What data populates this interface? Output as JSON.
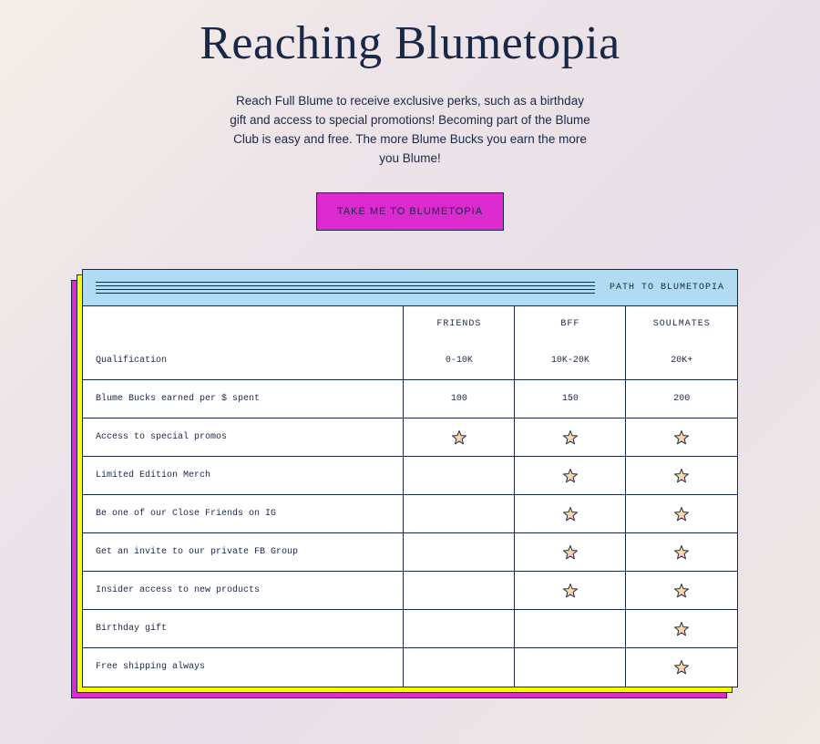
{
  "hero": {
    "title": "Reaching Blumetopia",
    "subtitle": "Reach Full Blume to receive exclusive perks, such as a birthday gift and access to special promotions! Becoming part of the Blume Club is easy and free. The more Blume Bucks you earn the more you Blume!",
    "cta": "TAKE ME TO BLUMETOPIA"
  },
  "card": {
    "header_label": "PATH TO BLUMETOPIA",
    "columns": [
      "",
      "FRIENDS",
      "BFF",
      "SOULMATES"
    ],
    "rows": [
      {
        "label": "Qualification",
        "cells": [
          "0-10K",
          "10K-20K",
          "20K+"
        ]
      },
      {
        "label": "Blume Bucks earned per $ spent",
        "cells": [
          "100",
          "150",
          "200"
        ]
      },
      {
        "label": "Access to special promos",
        "cells": [
          "star",
          "star",
          "star"
        ]
      },
      {
        "label": "Limited Edition Merch",
        "cells": [
          "",
          "star",
          "star"
        ]
      },
      {
        "label": "Be one of our Close Friends on IG",
        "cells": [
          "",
          "star",
          "star"
        ]
      },
      {
        "label": "Get an invite to our private FB Group",
        "cells": [
          "",
          "star",
          "star"
        ]
      },
      {
        "label": "Insider access to new products",
        "cells": [
          "",
          "star",
          "star"
        ]
      },
      {
        "label": "Birthday gift",
        "cells": [
          "",
          "",
          "star"
        ]
      },
      {
        "label": "Free shipping always",
        "cells": [
          "",
          "",
          "star"
        ]
      }
    ]
  }
}
